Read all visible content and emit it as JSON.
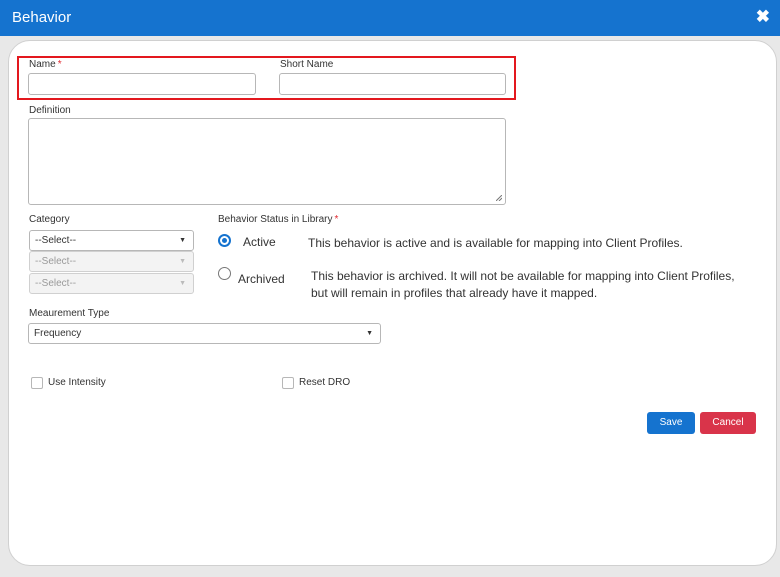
{
  "dialog": {
    "title": "Behavior",
    "close_glyph": "✖"
  },
  "form": {
    "name_label": "Name",
    "required_mark": "*",
    "name_value": "",
    "short_name_label": "Short Name",
    "short_name_value": "",
    "definition_label": "Definition",
    "definition_value": "",
    "category_label": "Category",
    "category_selects": [
      {
        "value": "--Select--",
        "enabled": true
      },
      {
        "value": "--Select--",
        "enabled": false
      },
      {
        "value": "--Select--",
        "enabled": false
      }
    ],
    "status_label": "Behavior Status in Library",
    "status_options": [
      {
        "label": "Active",
        "description": "This behavior is active and is available for mapping into Client Profiles.",
        "checked": true
      },
      {
        "label": "Archived",
        "description_lines": [
          "This behavior is archived. It will not be available for mapping into Client Profiles,",
          "but will remain in profiles that already have it mapped."
        ],
        "checked": false
      }
    ],
    "measurement_label": "Meaurement Type",
    "measurement_value": "Frequency",
    "use_intensity_label": "Use Intensity",
    "use_intensity_checked": false,
    "reset_dro_label": "Reset DRO",
    "reset_dro_checked": false
  },
  "buttons": {
    "save_label": "Save",
    "cancel_label": "Cancel"
  },
  "colors": {
    "titlebar": "#1573cf",
    "highlight_box": "#e3181e",
    "save_button": "#1573cf",
    "cancel_button": "#d9344a",
    "required": "#e0282e"
  }
}
